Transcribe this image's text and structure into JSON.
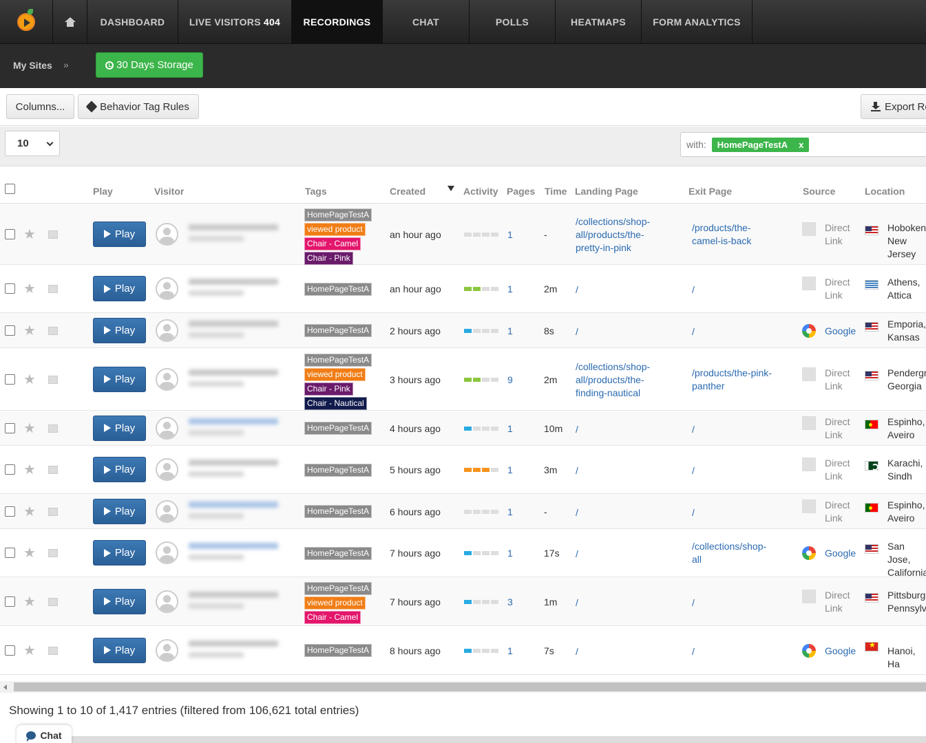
{
  "nav": {
    "items": [
      {
        "label": "DASHBOARD"
      },
      {
        "label": "LIVE VISITORS",
        "count": "404"
      },
      {
        "label": "RECORDINGS"
      },
      {
        "label": "CHAT"
      },
      {
        "label": "POLLS"
      },
      {
        "label": "HEATMAPS"
      },
      {
        "label": "FORM ANALYTICS"
      }
    ]
  },
  "subnav": {
    "my_sites": "My Sites",
    "chevron": "»",
    "storage": "30 Days Storage"
  },
  "toolbar": {
    "columns": "Columns...",
    "behavior_tag_rules": "Behavior Tag Rules",
    "export": "Export Ro"
  },
  "filter": {
    "page_size": "10",
    "with_label": "with:",
    "with_tag": "HomePageTestA",
    "with_tag_remove": "x"
  },
  "table": {
    "headers": {
      "play": "Play",
      "visitor": "Visitor",
      "tags": "Tags",
      "created": "Created",
      "activity": "Activity",
      "pages": "Pages",
      "time": "Time",
      "landing": "Landing Page",
      "exit": "Exit Page",
      "source": "Source",
      "location": "Location"
    },
    "play_label": "Play",
    "rows": [
      {
        "tags": [
          [
            "HomePageTestA",
            "gray"
          ],
          [
            "viewed product",
            "orange"
          ],
          [
            "Chair - Camel",
            "pink"
          ],
          [
            "Chair - Pink",
            "purple"
          ]
        ],
        "created": "an hour ago",
        "activity": {
          "level": 0,
          "color": "#dddddd"
        },
        "pages": "1",
        "time": "-",
        "landing": "/collections/shop-all/products/the-pretty-in-pink",
        "exit": "/products/the-camel-is-back",
        "source": "Direct Link",
        "source_type": "direct",
        "flag": "us",
        "location": "Hoboken, New Jersey"
      },
      {
        "tags": [
          [
            "HomePageTestA",
            "gray"
          ]
        ],
        "created": "an hour ago",
        "activity": {
          "level": 2,
          "color": "#8cc63f"
        },
        "pages": "1",
        "time": "2m",
        "landing": "/",
        "exit": "/",
        "source": "Direct Link",
        "source_type": "direct",
        "flag": "gr",
        "location": "Athens, Attica"
      },
      {
        "tags": [
          [
            "HomePageTestA",
            "gray"
          ]
        ],
        "created": "2 hours ago",
        "activity": {
          "level": 1,
          "color": "#29abe2"
        },
        "pages": "1",
        "time": "8s",
        "landing": "/",
        "exit": "/",
        "source": "Google",
        "source_type": "google",
        "flag": "us",
        "location": "Emporia, Kansas"
      },
      {
        "tags": [
          [
            "HomePageTestA",
            "gray"
          ],
          [
            "viewed product",
            "orange"
          ],
          [
            "Chair - Pink",
            "purple"
          ],
          [
            "Chair - Nautical",
            "navy"
          ]
        ],
        "created": "3 hours ago",
        "activity": {
          "level": 2,
          "color": "#8cc63f"
        },
        "pages": "9",
        "time": "2m",
        "landing": "/collections/shop-all/products/the-finding-nautical",
        "exit": "/products/the-pink-panther",
        "source": "Direct Link",
        "source_type": "direct",
        "flag": "us",
        "location": "Pendergrass, Georgia"
      },
      {
        "tags": [
          [
            "HomePageTestA",
            "gray"
          ]
        ],
        "created": "4 hours ago",
        "activity": {
          "level": 1,
          "color": "#29abe2"
        },
        "pages": "1",
        "time": "10m",
        "landing": "/",
        "exit": "/",
        "source": "Direct Link",
        "source_type": "direct",
        "flag": "pt",
        "location": "Espinho, Aveiro"
      },
      {
        "tags": [
          [
            "HomePageTestA",
            "gray"
          ]
        ],
        "created": "5 hours ago",
        "activity": {
          "level": 3,
          "color": "#f7931e"
        },
        "pages": "1",
        "time": "3m",
        "landing": "/",
        "exit": "/",
        "source": "Direct Link",
        "source_type": "direct",
        "flag": "pk",
        "location": "Karachi, Sindh"
      },
      {
        "tags": [
          [
            "HomePageTestA",
            "gray"
          ]
        ],
        "created": "6 hours ago",
        "activity": {
          "level": 0,
          "color": "#dddddd"
        },
        "pages": "1",
        "time": "-",
        "landing": "/",
        "exit": "/",
        "source": "Direct Link",
        "source_type": "direct",
        "flag": "pt",
        "location": "Espinho, Aveiro"
      },
      {
        "tags": [
          [
            "HomePageTestA",
            "gray"
          ]
        ],
        "created": "7 hours ago",
        "activity": {
          "level": 1,
          "color": "#29abe2"
        },
        "pages": "1",
        "time": "17s",
        "landing": "/",
        "exit": "/collections/shop-all",
        "source": "Google",
        "source_type": "google",
        "flag": "us",
        "location": "San Jose, California"
      },
      {
        "tags": [
          [
            "HomePageTestA",
            "gray"
          ],
          [
            "viewed product",
            "orange"
          ],
          [
            "Chair - Camel",
            "pink"
          ]
        ],
        "created": "7 hours ago",
        "activity": {
          "level": 1,
          "color": "#29abe2"
        },
        "pages": "3",
        "time": "1m",
        "landing": "/",
        "exit": "/",
        "source": "Direct Link",
        "source_type": "direct",
        "flag": "us",
        "location": "Pittsburgh, Pennsylvania"
      },
      {
        "tags": [
          [
            "HomePageTestA",
            "gray"
          ]
        ],
        "created": "8 hours ago",
        "activity": {
          "level": 1,
          "color": "#29abe2"
        },
        "pages": "1",
        "time": "7s",
        "landing": "/",
        "exit": "/",
        "source": "Google",
        "source_type": "google",
        "flag": "vn",
        "location": "Hanoi, Ha"
      }
    ]
  },
  "footer": {
    "showing": "Showing 1 to 10 of 1,417 entries (filtered from 106,621 total entries)",
    "chat": "Chat"
  }
}
